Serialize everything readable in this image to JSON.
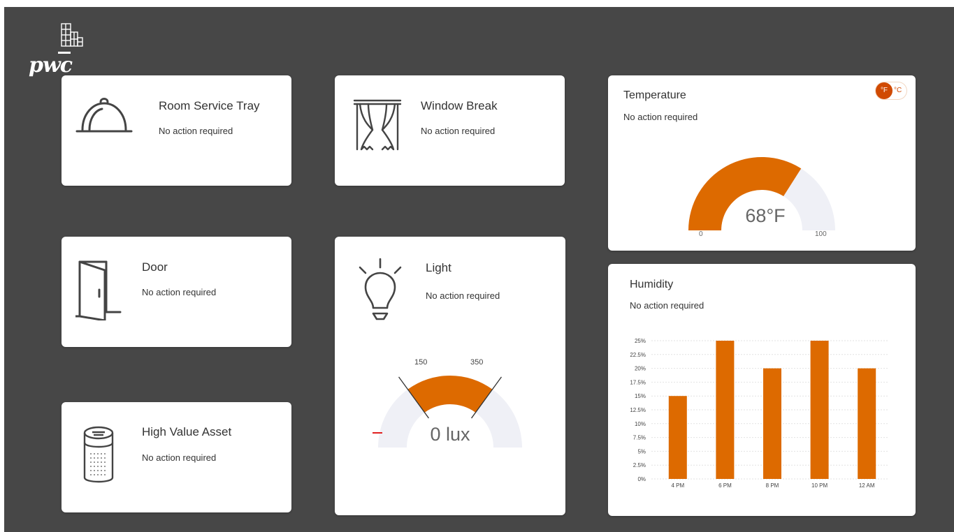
{
  "logo": {
    "text": "pwc"
  },
  "cards": {
    "room_service": {
      "title": "Room Service Tray",
      "status": "No action required",
      "icon": "room-service-tray-icon"
    },
    "window": {
      "title": "Window Break",
      "status": "No action required",
      "icon": "window-curtain-icon"
    },
    "door": {
      "title": "Door",
      "status": "No action required",
      "icon": "door-icon"
    },
    "light": {
      "title": "Light",
      "status": "No action required",
      "icon": "light-bulb-icon"
    },
    "asset": {
      "title": "High Value Asset",
      "status": "No action required",
      "icon": "smart-speaker-icon"
    }
  },
  "temperature": {
    "title": "Temperature",
    "status": "No action required",
    "unit_selected": "°F",
    "unit_other": "°C",
    "value_label": "68°F",
    "value": 68,
    "min_label": "0",
    "max_label": "100",
    "min": 0,
    "max": 100,
    "accent": "#dd6a00",
    "track": "#eff0f6"
  },
  "light_gauge": {
    "value_label": "0 lux",
    "value": 0,
    "range_low_label": "150",
    "range_high_label": "350",
    "range_low": 150,
    "range_high": 350,
    "min": 0,
    "max": 500,
    "accent": "#dd6a00",
    "indicator": "#e02020"
  },
  "humidity": {
    "title": "Humidity",
    "status": "No action required"
  },
  "chart_data": {
    "type": "bar",
    "categories": [
      "4 PM",
      "6 PM",
      "8 PM",
      "10 PM",
      "12 AM"
    ],
    "values": [
      15,
      25,
      20,
      25,
      20
    ],
    "ylim": [
      0,
      25
    ],
    "yticks": [
      "0%",
      "2.5%",
      "5%",
      "7.5%",
      "10%",
      "12.5%",
      "15%",
      "17.5%",
      "20%",
      "22.5%",
      "25%"
    ],
    "color": "#dd6a00",
    "grid": true
  }
}
